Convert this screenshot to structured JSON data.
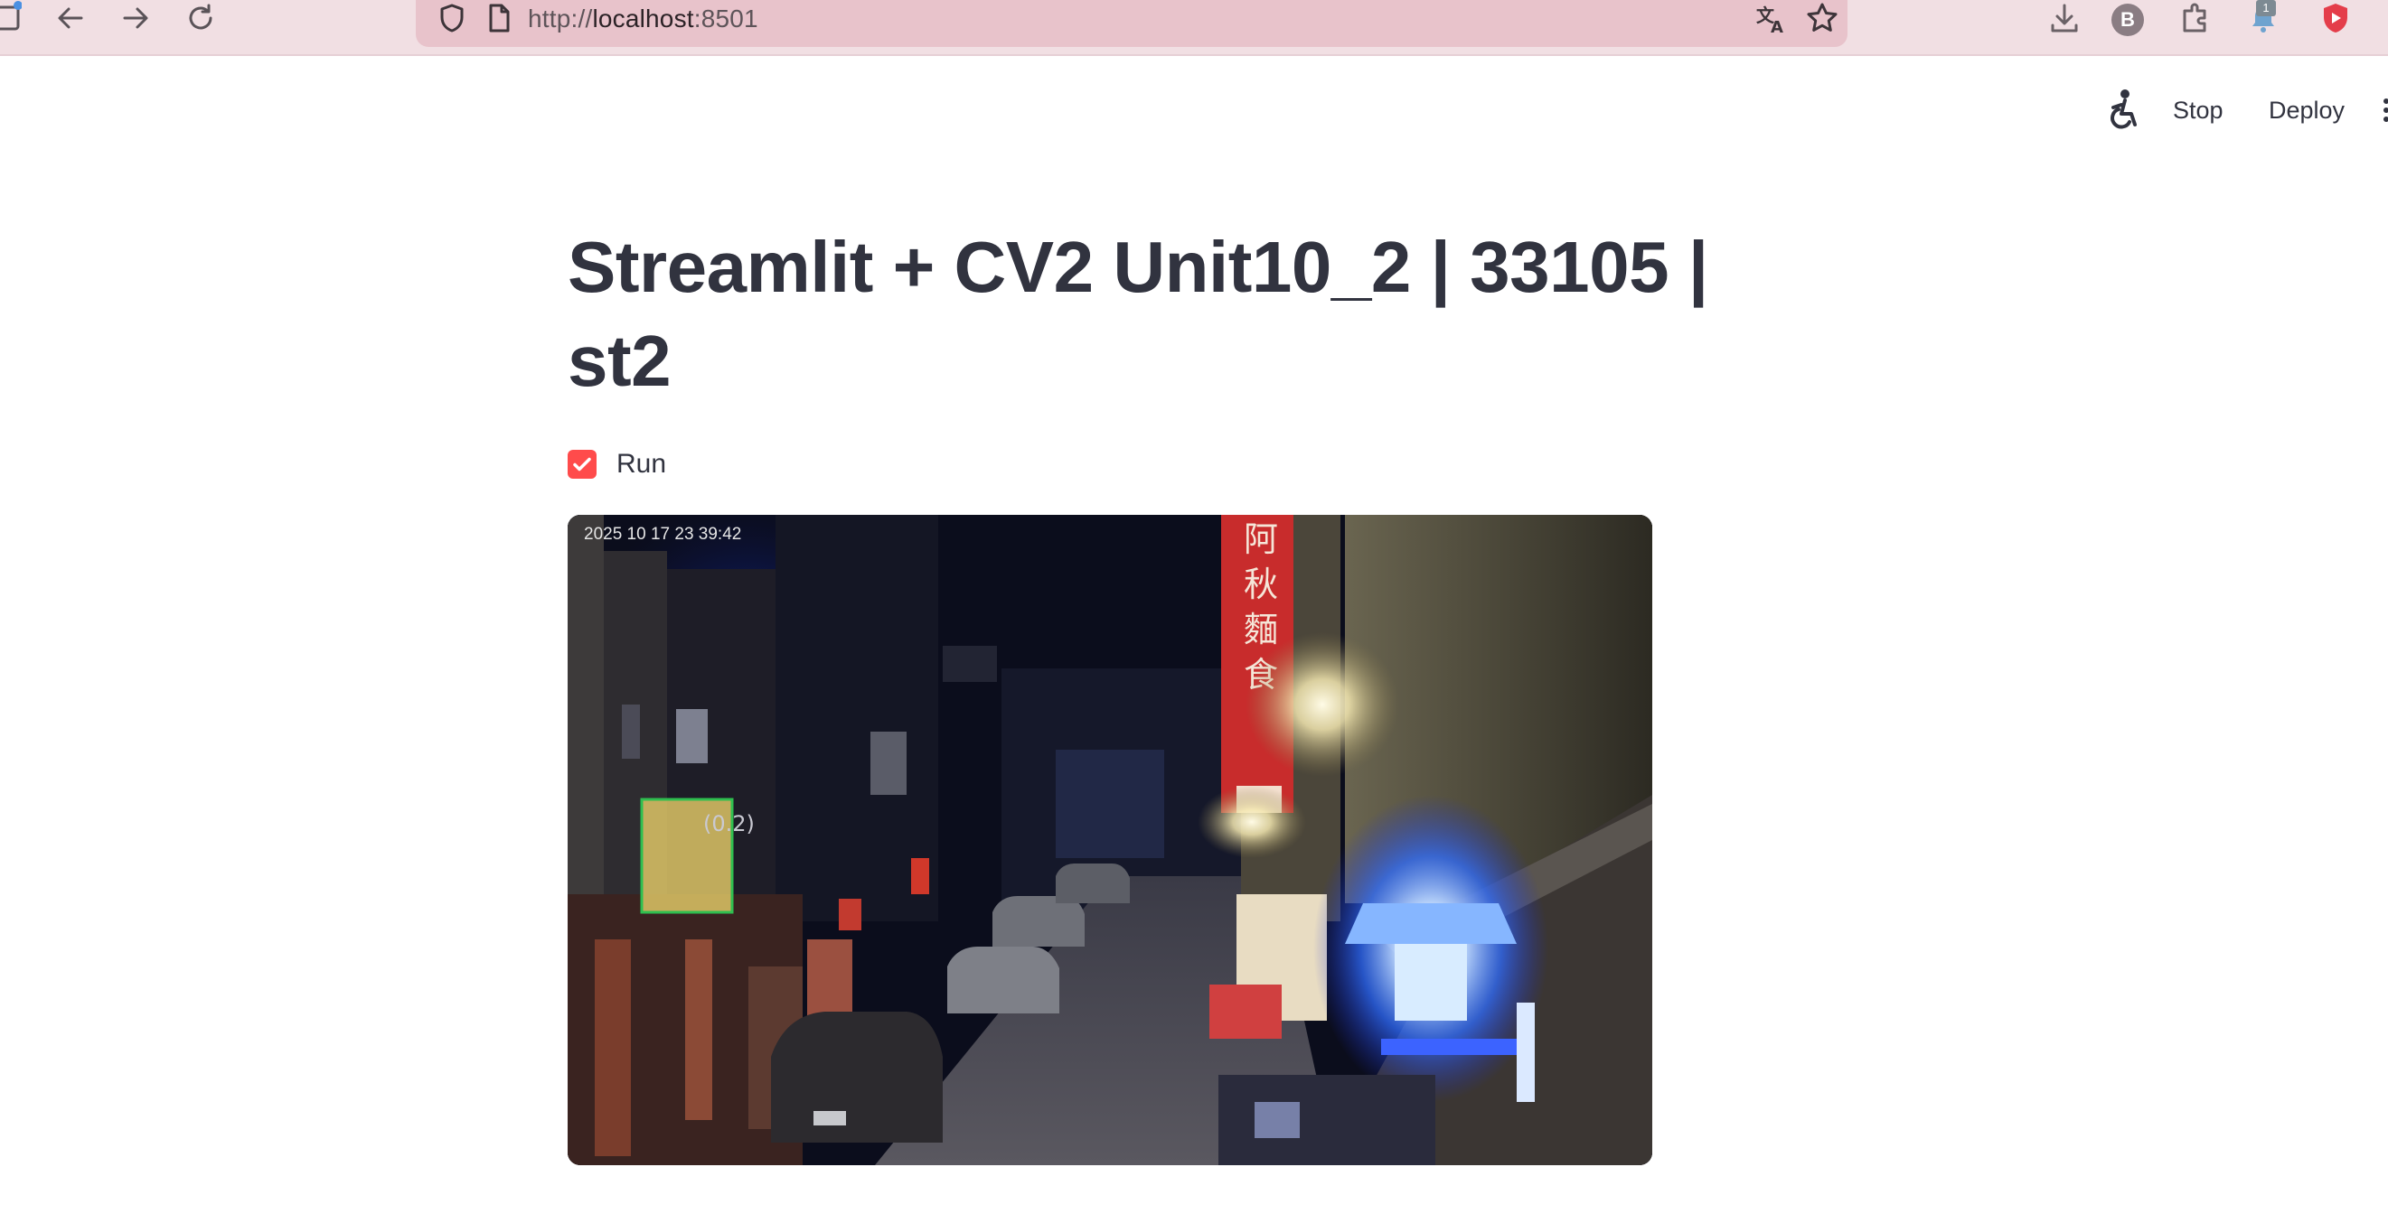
{
  "browser": {
    "url_scheme": "http://",
    "url_host": "localhost",
    "url_port": ":8501",
    "profile_initial": "B",
    "notification_count": "1"
  },
  "header": {
    "stop_label": "Stop",
    "deploy_label": "Deploy"
  },
  "main": {
    "title": "Streamlit + CV2 Unit10_2 | 33105 | st2",
    "checkbox": {
      "label": "Run",
      "checked": true
    },
    "video_frame": {
      "timestamp": "2025 10 17 23 39:42",
      "detection_label": "(0.2)"
    }
  },
  "colors": {
    "toolbar_bg": "#f1dfe3",
    "urlbar_bg": "#e8c3cb",
    "checkbox_accent": "#ff4b4b",
    "title_text": "#31333f",
    "detection_box": "#2fbf4f"
  }
}
